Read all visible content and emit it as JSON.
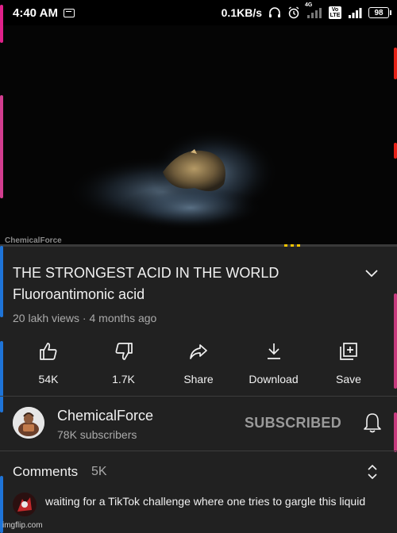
{
  "status_bar": {
    "time": "4:40 AM",
    "net_speed": "0.1KB/s",
    "network_label": "4G",
    "volte_label": "Vo LTE",
    "battery": "98"
  },
  "video": {
    "watermark": "ChemicalForce",
    "progress_fraction": 0.0
  },
  "title": {
    "main": "THE STRONGEST ACID IN THE WORLD",
    "sub": "Fluoroantimonic acid",
    "meta": "20 lakh views · 4 months ago"
  },
  "actions": [
    {
      "icon": "thumbs-up-icon",
      "label": "54K"
    },
    {
      "icon": "thumbs-down-icon",
      "label": "1.7K"
    },
    {
      "icon": "share-icon",
      "label": "Share"
    },
    {
      "icon": "download-icon",
      "label": "Download"
    },
    {
      "icon": "save-icon",
      "label": "Save"
    }
  ],
  "channel": {
    "name": "ChemicalForce",
    "subscribers": "78K subscribers",
    "subscribe_state": "SUBSCRIBED"
  },
  "comments": {
    "title": "Comments",
    "count": "5K",
    "top_comment": "waiting for a TikTok challenge where one tries to gargle this liquid"
  },
  "footer": {
    "site_watermark": "imgflip.com"
  },
  "colors": {
    "background": "#212121",
    "accent_red": "#e62117",
    "secondary_text": "#aaaaaa"
  }
}
